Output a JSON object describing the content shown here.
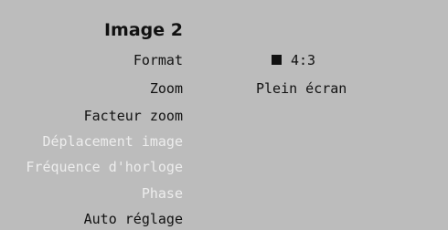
{
  "menu": {
    "title": "Image 2",
    "items": [
      {
        "label": "Format",
        "enabled": true
      },
      {
        "label": "Zoom",
        "enabled": true
      },
      {
        "label": "Facteur zoom",
        "enabled": true
      },
      {
        "label": "Déplacement image",
        "enabled": false
      },
      {
        "label": "Fréquence d'horloge",
        "enabled": false
      },
      {
        "label": "Phase",
        "enabled": false
      },
      {
        "label": "Auto réglage",
        "enabled": true
      }
    ]
  },
  "values": {
    "format": "4:3",
    "zoom": "Plein écran"
  },
  "colors": {
    "background": "#bcbcbc",
    "text": "#111111",
    "disabled_text": "#ededed"
  }
}
